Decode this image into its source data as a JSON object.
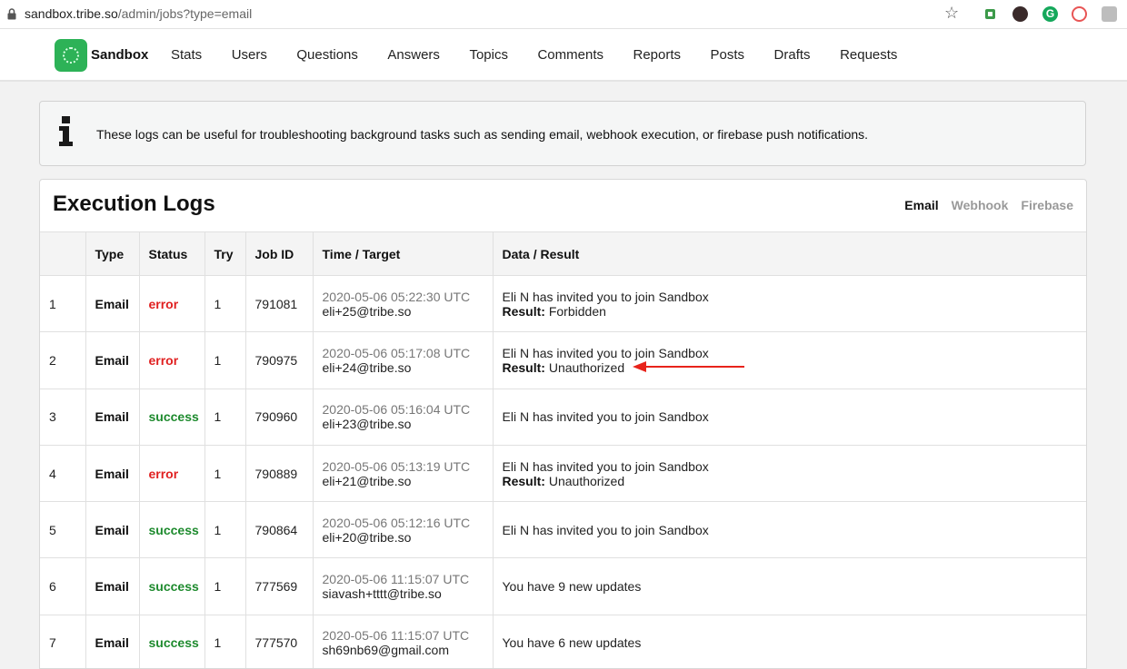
{
  "browser": {
    "url_host": "sandbox.tribe.so",
    "url_path": "/admin/jobs?type=email"
  },
  "site": {
    "brand": "Sandbox",
    "nav": [
      "Stats",
      "Users",
      "Questions",
      "Answers",
      "Topics",
      "Comments",
      "Reports",
      "Posts",
      "Drafts",
      "Requests"
    ]
  },
  "alert": {
    "text": "These logs can be useful for troubleshooting background tasks such as sending email, webhook execution, or firebase push notifications."
  },
  "panel": {
    "title": "Execution Logs",
    "tabs": [
      {
        "label": "Email",
        "active": true
      },
      {
        "label": "Webhook",
        "active": false
      },
      {
        "label": "Firebase",
        "active": false
      }
    ]
  },
  "table": {
    "headers": [
      "",
      "Type",
      "Status",
      "Try",
      "Job ID",
      "Time / Target",
      "Data / Result"
    ],
    "result_label": "Result:",
    "rows": [
      {
        "num": "1",
        "type": "Email",
        "status": "error",
        "try": "1",
        "job_id": "791081",
        "time": "2020-05-06 05:22:30 UTC",
        "target": "eli+25@tribe.so",
        "data": "Eli N has invited you to join Sandbox",
        "result": "Forbidden"
      },
      {
        "num": "2",
        "type": "Email",
        "status": "error",
        "try": "1",
        "job_id": "790975",
        "time": "2020-05-06 05:17:08 UTC",
        "target": "eli+24@tribe.so",
        "data": "Eli N has invited you to join Sandbox",
        "result": "Unauthorized"
      },
      {
        "num": "3",
        "type": "Email",
        "status": "success",
        "try": "1",
        "job_id": "790960",
        "time": "2020-05-06 05:16:04 UTC",
        "target": "eli+23@tribe.so",
        "data": "Eli N has invited you to join Sandbox",
        "result": ""
      },
      {
        "num": "4",
        "type": "Email",
        "status": "error",
        "try": "1",
        "job_id": "790889",
        "time": "2020-05-06 05:13:19 UTC",
        "target": "eli+21@tribe.so",
        "data": "Eli N has invited you to join Sandbox",
        "result": "Unauthorized"
      },
      {
        "num": "5",
        "type": "Email",
        "status": "success",
        "try": "1",
        "job_id": "790864",
        "time": "2020-05-06 05:12:16 UTC",
        "target": "eli+20@tribe.so",
        "data": "Eli N has invited you to join Sandbox",
        "result": ""
      },
      {
        "num": "6",
        "type": "Email",
        "status": "success",
        "try": "1",
        "job_id": "777569",
        "time": "2020-05-06 11:15:07 UTC",
        "target": "siavash+tttt@tribe.so",
        "data": "You have 9 new updates",
        "result": ""
      },
      {
        "num": "7",
        "type": "Email",
        "status": "success",
        "try": "1",
        "job_id": "777570",
        "time": "2020-05-06 11:15:07 UTC",
        "target": "sh69nb69@gmail.com",
        "data": "You have 6 new updates",
        "result": ""
      }
    ]
  },
  "colors": {
    "error": "#e02020",
    "success": "#1d8a2d",
    "brand": "#2db257",
    "annotation_arrow": "#e8231b"
  },
  "icons": {
    "lock": "lock-icon",
    "star": "star-icon",
    "info": "info-icon"
  }
}
